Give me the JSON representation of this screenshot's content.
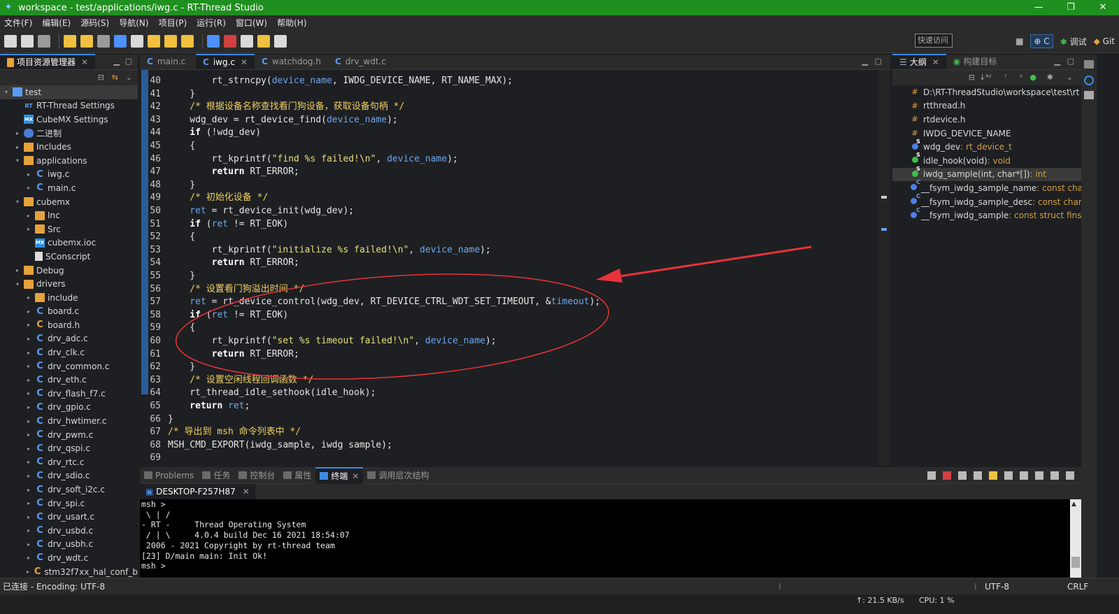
{
  "window": {
    "title": "workspace - test/applications/iwg.c - RT-Thread Studio"
  },
  "menu": [
    "文件(F)",
    "编辑(E)",
    "源码(S)",
    "导航(N)",
    "项目(P)",
    "运行(R)",
    "窗口(W)",
    "帮助(H)"
  ],
  "toolbar": {
    "quick_access": "快速访问",
    "perspective_c": "C",
    "perspective_debug": "调试",
    "perspective_git": "Git"
  },
  "explorer": {
    "tab": "项目资源管理器",
    "items": [
      {
        "label": "test",
        "depth": 0,
        "arrow": "▾",
        "icon": "proj",
        "selected": true
      },
      {
        "label": "RT-Thread Settings",
        "depth": 1,
        "arrow": "",
        "icon": "rt"
      },
      {
        "label": "CubeMX Settings",
        "depth": 1,
        "arrow": "",
        "icon": "mx"
      },
      {
        "label": "二进制",
        "depth": 1,
        "arrow": "▸",
        "icon": "bin"
      },
      {
        "label": "Includes",
        "depth": 1,
        "arrow": "▸",
        "icon": "folder"
      },
      {
        "label": "applications",
        "depth": 1,
        "arrow": "▾",
        "icon": "folder"
      },
      {
        "label": "iwg.c",
        "depth": 2,
        "arrow": "▸",
        "icon": "c"
      },
      {
        "label": "main.c",
        "depth": 2,
        "arrow": "▸",
        "icon": "c"
      },
      {
        "label": "cubemx",
        "depth": 1,
        "arrow": "▾",
        "icon": "folder"
      },
      {
        "label": "Inc",
        "depth": 2,
        "arrow": "▸",
        "icon": "folder"
      },
      {
        "label": "Src",
        "depth": 2,
        "arrow": "▸",
        "icon": "folder"
      },
      {
        "label": "cubemx.ioc",
        "depth": 2,
        "arrow": "",
        "icon": "mx"
      },
      {
        "label": "SConscript",
        "depth": 2,
        "arrow": "",
        "icon": "doc"
      },
      {
        "label": "Debug",
        "depth": 1,
        "arrow": "▸",
        "icon": "folder"
      },
      {
        "label": "drivers",
        "depth": 1,
        "arrow": "▾",
        "icon": "folder"
      },
      {
        "label": "include",
        "depth": 2,
        "arrow": "▸",
        "icon": "folder"
      },
      {
        "label": "board.c",
        "depth": 2,
        "arrow": "▸",
        "icon": "c"
      },
      {
        "label": "board.h",
        "depth": 2,
        "arrow": "▸",
        "icon": "h"
      },
      {
        "label": "drv_adc.c",
        "depth": 2,
        "arrow": "▸",
        "icon": "c"
      },
      {
        "label": "drv_clk.c",
        "depth": 2,
        "arrow": "▸",
        "icon": "c"
      },
      {
        "label": "drv_common.c",
        "depth": 2,
        "arrow": "▸",
        "icon": "c"
      },
      {
        "label": "drv_eth.c",
        "depth": 2,
        "arrow": "▸",
        "icon": "c"
      },
      {
        "label": "drv_flash_f7.c",
        "depth": 2,
        "arrow": "▸",
        "icon": "c"
      },
      {
        "label": "drv_gpio.c",
        "depth": 2,
        "arrow": "▸",
        "icon": "c"
      },
      {
        "label": "drv_hwtimer.c",
        "depth": 2,
        "arrow": "▸",
        "icon": "c"
      },
      {
        "label": "drv_pwm.c",
        "depth": 2,
        "arrow": "▸",
        "icon": "c"
      },
      {
        "label": "drv_qspi.c",
        "depth": 2,
        "arrow": "▸",
        "icon": "c"
      },
      {
        "label": "drv_rtc.c",
        "depth": 2,
        "arrow": "▸",
        "icon": "c"
      },
      {
        "label": "drv_sdio.c",
        "depth": 2,
        "arrow": "▸",
        "icon": "c"
      },
      {
        "label": "drv_soft_i2c.c",
        "depth": 2,
        "arrow": "▸",
        "icon": "c"
      },
      {
        "label": "drv_spi.c",
        "depth": 2,
        "arrow": "▸",
        "icon": "c"
      },
      {
        "label": "drv_usart.c",
        "depth": 2,
        "arrow": "▸",
        "icon": "c"
      },
      {
        "label": "drv_usbd.c",
        "depth": 2,
        "arrow": "▸",
        "icon": "c"
      },
      {
        "label": "drv_usbh.c",
        "depth": 2,
        "arrow": "▸",
        "icon": "c"
      },
      {
        "label": "drv_wdt.c",
        "depth": 2,
        "arrow": "▸",
        "icon": "c"
      },
      {
        "label": "stm32f7xx_hal_conf_b",
        "depth": 2,
        "arrow": "▸",
        "icon": "h"
      }
    ]
  },
  "editor": {
    "tabs": [
      {
        "label": "main.c",
        "active": false
      },
      {
        "label": "iwg.c",
        "active": true
      },
      {
        "label": "watchdog.h",
        "active": false
      },
      {
        "label": "drv_wdt.c",
        "active": false
      }
    ],
    "lines": [
      {
        "n": "40",
        "code": [
          [
            "",
            "        rt_strncpy("
          ],
          [
            "var",
            "device_name"
          ],
          [
            "",
            ", IWDG_DEVICE_NAME, RT_NAME_MAX);"
          ]
        ]
      },
      {
        "n": "41",
        "code": [
          [
            "",
            "    }"
          ]
        ]
      },
      {
        "n": "42",
        "code": [
          [
            "cm",
            "    /* 根据设备名称查找看门狗设备，获取设备句柄 */"
          ]
        ]
      },
      {
        "n": "43",
        "code": [
          [
            "",
            "    wdg_dev = rt_device_find("
          ],
          [
            "var",
            "device_name"
          ],
          [
            "",
            ");"
          ]
        ]
      },
      {
        "n": "44",
        "code": [
          [
            "kw",
            "    if"
          ],
          [
            "",
            " (!wdg_dev)"
          ]
        ]
      },
      {
        "n": "45",
        "code": [
          [
            "",
            "    {"
          ]
        ]
      },
      {
        "n": "46",
        "code": [
          [
            "",
            "        rt_kprintf("
          ],
          [
            "st",
            "\"find %s failed!\\n\""
          ],
          [
            "",
            ", "
          ],
          [
            "var",
            "device_name"
          ],
          [
            "",
            ");"
          ]
        ]
      },
      {
        "n": "47",
        "code": [
          [
            "kw",
            "        return"
          ],
          [
            "",
            " RT_ERROR;"
          ]
        ]
      },
      {
        "n": "48",
        "code": [
          [
            "",
            "    }"
          ]
        ]
      },
      {
        "n": "49",
        "code": [
          [
            "cm",
            "    /* 初始化设备 */"
          ]
        ]
      },
      {
        "n": "50",
        "code": [
          [
            "var",
            "    ret"
          ],
          [
            "",
            " = rt_device_init(wdg_dev);"
          ]
        ]
      },
      {
        "n": "51",
        "code": [
          [
            "kw",
            "    if"
          ],
          [
            "",
            " ("
          ],
          [
            "var",
            "ret"
          ],
          [
            "",
            " != RT_EOK)"
          ]
        ]
      },
      {
        "n": "52",
        "code": [
          [
            "",
            "    {"
          ]
        ]
      },
      {
        "n": "53",
        "code": [
          [
            "",
            "        rt_kprintf("
          ],
          [
            "st",
            "\"initialize %s failed!\\n\""
          ],
          [
            "",
            ", "
          ],
          [
            "var",
            "device_name"
          ],
          [
            "",
            ");"
          ]
        ]
      },
      {
        "n": "54",
        "code": [
          [
            "kw",
            "        return"
          ],
          [
            "",
            " RT_ERROR;"
          ]
        ]
      },
      {
        "n": "55",
        "code": [
          [
            "",
            "    }"
          ]
        ]
      },
      {
        "n": "56",
        "code": [
          [
            "cm",
            "    /* 设置看门狗溢出时间 */"
          ]
        ]
      },
      {
        "n": "57",
        "code": [
          [
            "var",
            "    ret"
          ],
          [
            "",
            " = rt_device_control(wdg_dev, RT_DEVICE_CTRL_WDT_SET_TIMEOUT, &"
          ],
          [
            "var",
            "timeout"
          ],
          [
            "",
            ");"
          ]
        ]
      },
      {
        "n": "58",
        "code": [
          [
            "kw",
            "    if"
          ],
          [
            "",
            " ("
          ],
          [
            "var",
            "ret"
          ],
          [
            "",
            " != RT_EOK)"
          ]
        ]
      },
      {
        "n": "59",
        "code": [
          [
            "",
            "    {"
          ]
        ]
      },
      {
        "n": "60",
        "code": [
          [
            "",
            "        rt_kprintf("
          ],
          [
            "st",
            "\"set %s timeout failed!\\n\""
          ],
          [
            "",
            ", "
          ],
          [
            "var",
            "device_name"
          ],
          [
            "",
            ");"
          ]
        ]
      },
      {
        "n": "61",
        "code": [
          [
            "kw",
            "        return"
          ],
          [
            "",
            " RT_ERROR;"
          ]
        ]
      },
      {
        "n": "62",
        "code": [
          [
            "",
            "    }"
          ]
        ]
      },
      {
        "n": "63",
        "code": [
          [
            "cm",
            "    /* 设置空闲线程回调函数 */"
          ]
        ]
      },
      {
        "n": "64",
        "code": [
          [
            "",
            "    rt_thread_idle_sethook(idle_hook);"
          ]
        ]
      },
      {
        "n": "65",
        "code": [
          [
            "kw",
            "    return"
          ],
          [
            "",
            " "
          ],
          [
            "var",
            "ret"
          ],
          [
            "",
            ";"
          ]
        ]
      },
      {
        "n": "66",
        "code": [
          [
            "",
            "}"
          ]
        ]
      },
      {
        "n": "67",
        "code": [
          [
            "cm",
            "/* 导出到 msh 命令列表中 */"
          ]
        ]
      },
      {
        "n": "68",
        "code": [
          [
            "",
            "MSH_CMD_EXPORT(iwdg_sample, iwdg sample);"
          ]
        ]
      },
      {
        "n": "69",
        "code": [
          [
            "",
            ""
          ]
        ]
      }
    ]
  },
  "outline": {
    "tabs": [
      "大纲",
      "构建目标"
    ],
    "items": [
      {
        "icon": "hash",
        "label": "D:\\RT-ThreadStudio\\workspace\\test\\rt",
        "type": ""
      },
      {
        "icon": "hash",
        "label": "rtthread.h",
        "type": ""
      },
      {
        "icon": "hash",
        "label": "rtdevice.h",
        "type": ""
      },
      {
        "icon": "hash",
        "label": "IWDG_DEVICE_NAME",
        "type": ""
      },
      {
        "icon": "blue",
        "sup": "S",
        "label": "wdg_dev",
        "type": " : rt_device_t"
      },
      {
        "icon": "green",
        "sup": "S",
        "label": "idle_hook(void)",
        "type": " : void"
      },
      {
        "icon": "green",
        "sup": "S",
        "label": "iwdg_sample(int, char*[])",
        "type": " : int",
        "selected": true
      },
      {
        "icon": "blue",
        "sup": "C",
        "label": "__fsym_iwdg_sample_name",
        "type": " : const cha"
      },
      {
        "icon": "blue",
        "sup": "C",
        "label": "__fsym_iwdg_sample_desc",
        "type": " : const char"
      },
      {
        "icon": "blue",
        "sup": "C",
        "label": "__fsym_iwdg_sample",
        "type": " : const struct finsh"
      }
    ]
  },
  "bottom": {
    "tabs": [
      {
        "label": "Problems",
        "active": false
      },
      {
        "label": "任务",
        "active": false
      },
      {
        "label": "控制台",
        "active": false
      },
      {
        "label": "属性",
        "active": false
      },
      {
        "label": "终端",
        "active": true
      },
      {
        "label": "调用层次结构",
        "active": false
      }
    ],
    "session": "DESKTOP-F257H87",
    "terminal": "msh >\n \\ | /\n- RT -     Thread Operating System\n / | \\     4.0.4 build Dec 16 2021 18:54:07\n 2006 - 2021 Copyright by rt-thread team\n[23] D/main main: Init Ok!\nmsh >"
  },
  "status": {
    "left": "已连接 - Encoding: UTF-8",
    "encoding": "UTF-8",
    "eol": "CRLF"
  },
  "taskbar": {
    "net": "↑: 21.5 KB/s",
    "cpu": "CPU: 1 %"
  },
  "colors": {
    "titlebar": "#1f8f1f",
    "annotation": "#e8333a"
  }
}
